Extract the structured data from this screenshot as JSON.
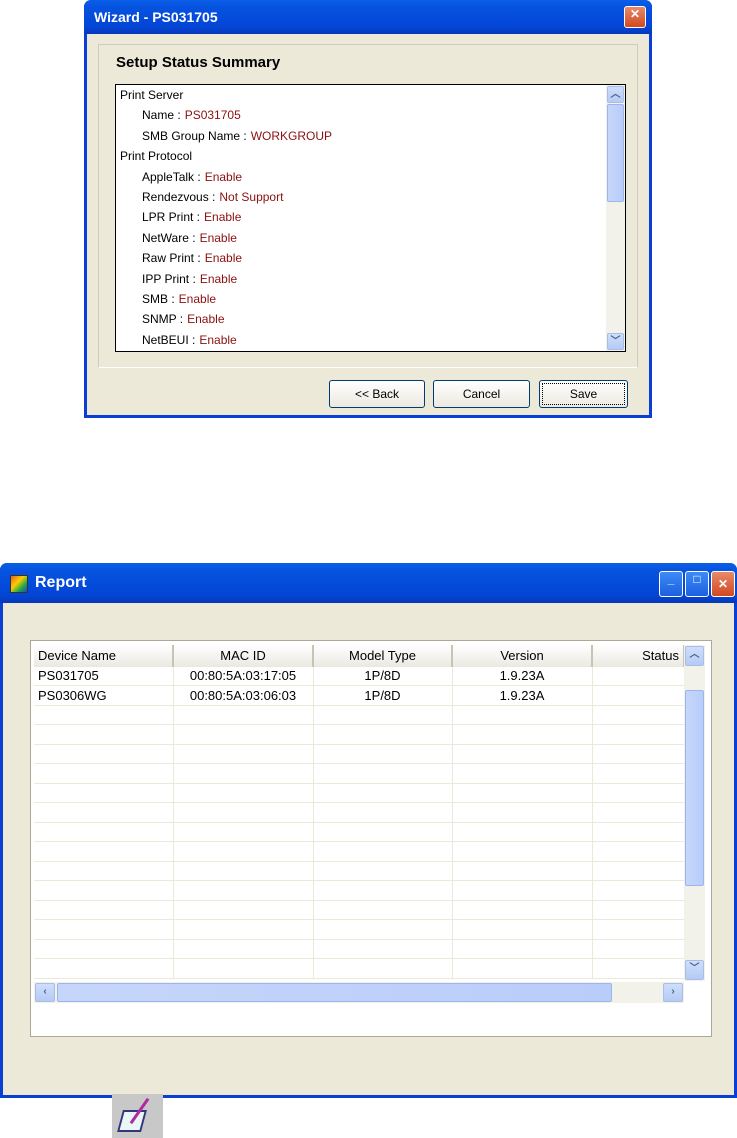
{
  "wizard": {
    "title": "Wizard - PS031705",
    "heading": "Setup Status Summary",
    "sections": [
      {
        "label": "Print Server",
        "items": [
          {
            "key": "Name :",
            "value": "PS031705"
          },
          {
            "key": "SMB Group Name :",
            "value": "WORKGROUP"
          }
        ]
      },
      {
        "label": "Print Protocol",
        "items": [
          {
            "key": "AppleTalk :",
            "value": "Enable"
          },
          {
            "key": "Rendezvous :",
            "value": "Not Support"
          },
          {
            "key": "LPR Print :",
            "value": "Enable"
          },
          {
            "key": "NetWare :",
            "value": "Enable"
          },
          {
            "key": "Raw Print :",
            "value": "Enable"
          },
          {
            "key": "IPP Print :",
            "value": "Enable"
          },
          {
            "key": "SMB :",
            "value": "Enable"
          },
          {
            "key": "SNMP :",
            "value": "Enable"
          },
          {
            "key": "NetBEUI :",
            "value": "Enable"
          }
        ]
      }
    ],
    "buttons": {
      "back": "<< Back",
      "cancel": "Cancel",
      "save": "Save"
    }
  },
  "report": {
    "title": "Report",
    "columns": [
      "Device Name",
      "MAC ID",
      "Model Type",
      "Version",
      "Status"
    ],
    "rows": [
      [
        "PS031705",
        "00:80:5A:03:17:05",
        "1P/8D",
        "1.9.23A",
        ""
      ],
      [
        "PS0306WG",
        "00:80:5A:03:06:03",
        "1P/8D",
        "1.9.23A",
        ""
      ]
    ]
  }
}
